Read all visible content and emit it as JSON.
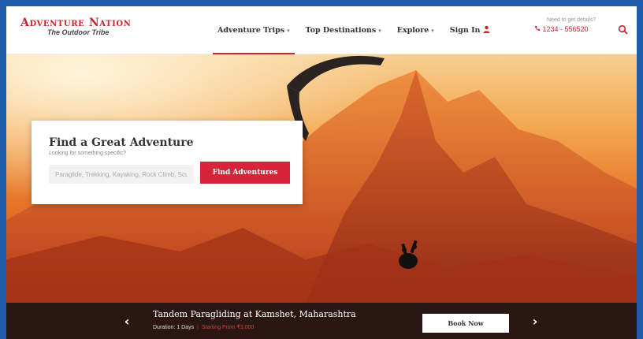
{
  "logo": {
    "name": "Adventure Nation",
    "tagline": "The Outdoor Tribe"
  },
  "nav": {
    "items": [
      {
        "label": "Adventure Trips",
        "caret": "▾"
      },
      {
        "label": "Top Destinations",
        "caret": "▾"
      },
      {
        "label": "Explore",
        "caret": "▾"
      }
    ],
    "signin_label": "Sign In",
    "signin_icon": "user-icon"
  },
  "help": {
    "label": "Need to get details?",
    "phone": "1234 - 556520"
  },
  "search_card": {
    "title": "Find a Great Adventure",
    "subtitle": "Looking for something specific?",
    "placeholder": "Paraglide, Trekking, Kayaking, Rock Climb, Scuba Dive",
    "button_label": "Find Adventures"
  },
  "banner": {
    "title": "Tandem Paragliding at Kamshet, Maharashtra",
    "duration": "Duration: 1 Days",
    "separator": "|",
    "price": "Starting From ₹3,000",
    "book_label": "Book Now",
    "prev_glyph": "‹",
    "next_glyph": "›"
  },
  "colors": {
    "brand": "#c9242b",
    "button": "#d6243a",
    "banner_bg": "#2a1714",
    "frame": "#1e5ca8"
  }
}
